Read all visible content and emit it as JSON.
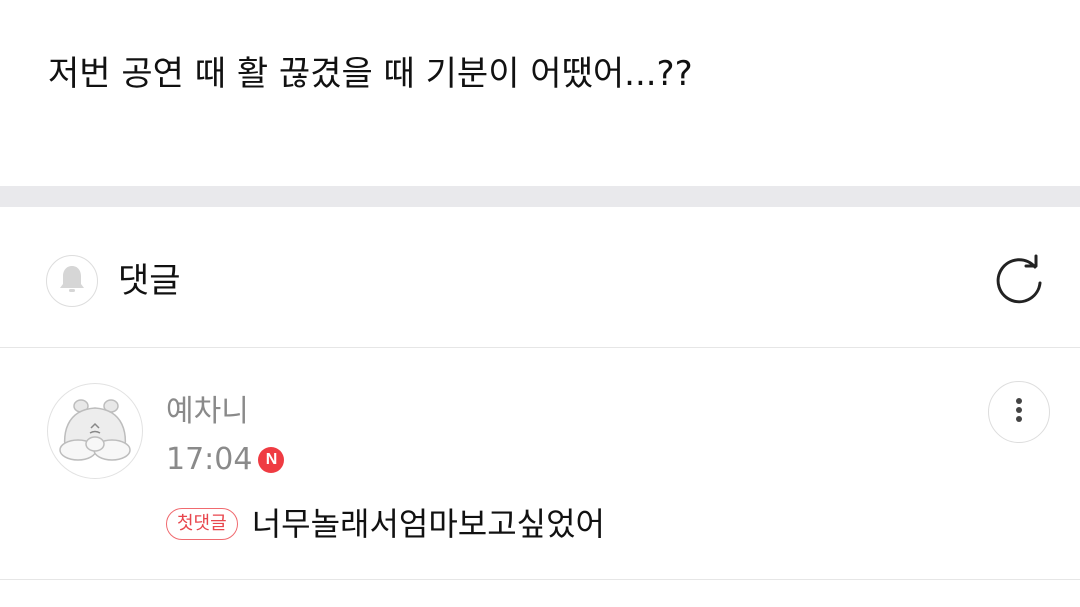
{
  "post": {
    "text": "저번 공연 때 활 끊겼을 때 기분이 어땠어...??"
  },
  "comments_header": {
    "title": "댓글",
    "bell_icon": "bell-icon",
    "refresh_icon": "refresh-icon"
  },
  "comments": [
    {
      "author": "예차니",
      "time": "17:04",
      "new_badge": "N",
      "first_badge": "첫댓글",
      "text": "너무놀래서엄마보고싶었어",
      "more_icon": "more-vertical-icon",
      "avatar_icon": "hamster-avatar-icon"
    }
  ],
  "colors": {
    "separator": "#e9e9ec",
    "badge_red": "#ef3b42",
    "meta_gray": "#8a8a8a"
  }
}
